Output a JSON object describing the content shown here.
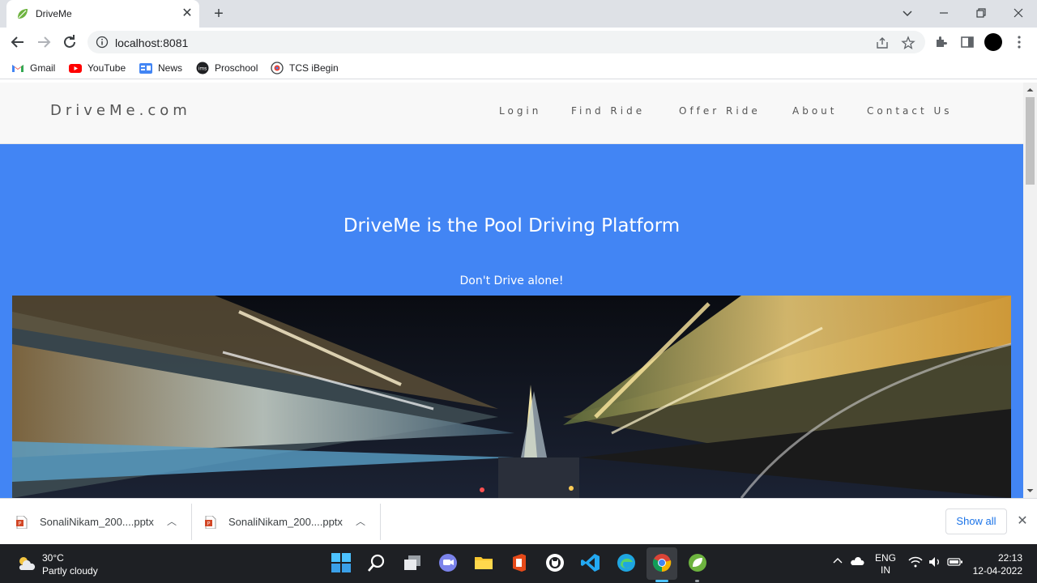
{
  "browser": {
    "tab": {
      "title": "DriveMe"
    },
    "address": "localhost:8081",
    "bookmarks": [
      {
        "label": "Gmail",
        "icon": "gmail-icon"
      },
      {
        "label": "YouTube",
        "icon": "youtube-icon"
      },
      {
        "label": "News",
        "icon": "google-news-icon"
      },
      {
        "label": "Proschool",
        "icon": "proschool-icon"
      },
      {
        "label": "TCS iBegin",
        "icon": "tcs-ibegin-icon"
      }
    ]
  },
  "site": {
    "brand": "DriveMe.com",
    "nav": [
      "Login",
      "Find Ride",
      "Offer Ride",
      "About",
      "Contact Us"
    ],
    "hero": {
      "title": "DriveMe is the Pool Driving Platform",
      "subtitle": "Don't Drive alone!",
      "background": "#4285f4"
    }
  },
  "downloads": {
    "items": [
      {
        "name": "SonaliNikam_200....pptx",
        "icon": "powerpoint-file-icon"
      },
      {
        "name": "SonaliNikam_200....pptx",
        "icon": "powerpoint-file-icon"
      }
    ],
    "show_all": "Show all"
  },
  "taskbar": {
    "weather": {
      "temp": "30°C",
      "desc": "Partly cloudy"
    },
    "lang": {
      "line1": "ENG",
      "line2": "IN"
    },
    "clock": {
      "time": "22:13",
      "date": "12-04-2022"
    }
  }
}
